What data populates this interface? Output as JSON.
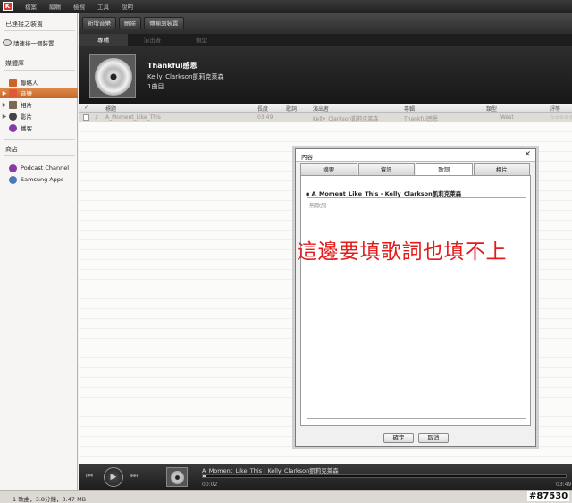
{
  "menubar": {
    "logo": "K",
    "items": [
      "檔案",
      "編輯",
      "檢視",
      "工具",
      "說明"
    ]
  },
  "sidebar": {
    "connected_header": "已連接之裝置",
    "connect_device": "請連接一個裝置",
    "library_header": "媒體庫",
    "library_items": [
      {
        "label": "聯絡人",
        "icon": "contacts-icon"
      },
      {
        "label": "音樂",
        "icon": "music-icon"
      },
      {
        "label": "相片",
        "icon": "photos-icon"
      },
      {
        "label": "影片",
        "icon": "videos-icon"
      },
      {
        "label": "播客",
        "icon": "podcast-icon"
      }
    ],
    "store_header": "商店",
    "store_items": [
      {
        "label": "Podcast Channel",
        "icon": "podcast-channel-icon"
      },
      {
        "label": "Samsung Apps",
        "icon": "samsung-apps-icon"
      }
    ]
  },
  "toolbar": {
    "add_music": "新增音樂",
    "delete": "刪除",
    "transfer": "傳輸到裝置"
  },
  "tabs": [
    "專輯",
    "演出者",
    "類型"
  ],
  "album": {
    "title": "Thankful感恩",
    "artist": "Kelly_Clarkson凱莉克萊森",
    "count": "1曲目"
  },
  "table": {
    "headers": [
      "標題",
      "長度",
      "歌詞",
      "演出者",
      "專輯",
      "類型",
      "評等"
    ],
    "row": {
      "title": "A_Moment_Like_This",
      "length": "03:49",
      "artist": "Kelly_Clarkson凱莉克萊森",
      "album": "Thankful感恩",
      "genre": "West",
      "rating": "☆☆☆☆☆"
    }
  },
  "player": {
    "now_playing": "A_Moment_Like_This | Kelly_Clarkson凱莉克萊森",
    "current_time": "00:02",
    "total_time": "03:49",
    "progress": 0.01
  },
  "status": {
    "text": "1 歌曲，3.8分鐘，3.47 MB",
    "watermark": "#87530"
  },
  "dialog": {
    "title": "內容",
    "tabs": [
      "摘要",
      "資訊",
      "歌詞",
      "相片"
    ],
    "song_line": "▪ A_Moment_Like_This - Kelly_Clarkson凱莉克萊森",
    "lyrics_placeholder": "無歌詞",
    "ok": "確定",
    "cancel": "取消"
  },
  "annotation": "這邊要填歌詞也填不上",
  "colors": {
    "accent": "#d0782f",
    "annotation": "#e21b1b"
  }
}
